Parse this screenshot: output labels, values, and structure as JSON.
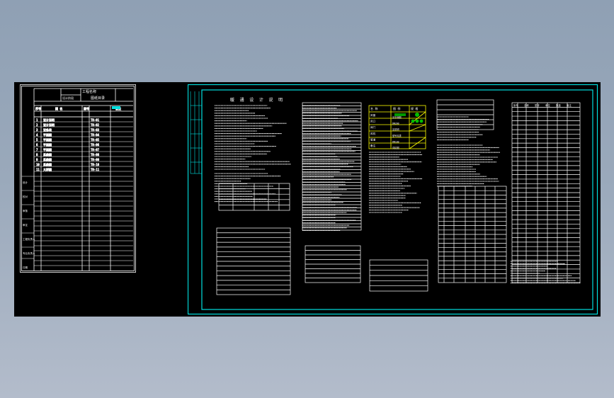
{
  "app": {
    "background": "#95a5b8",
    "canvas_bg": "#000000",
    "line_white": "#ffffff",
    "line_cyan": "#00e0e0",
    "line_yellow": "#ffff00",
    "fill_green": "#00c000"
  },
  "sheet_left": {
    "title_block": {
      "heading": "图纸目录",
      "label_a": "工程名称",
      "label_b": "设计阶段"
    },
    "columns": [
      "序号",
      "图号",
      "图 名",
      "备注"
    ],
    "rows": [
      {
        "num": "1",
        "name": "设计说明",
        "code": "TH-01"
      },
      {
        "num": "2",
        "name": "设计说明",
        "code": "TH-02"
      },
      {
        "num": "3",
        "name": "设备表",
        "code": "TH-03"
      },
      {
        "num": "4",
        "name": "平面图",
        "code": "TH-04"
      },
      {
        "num": "5",
        "name": "平面图",
        "code": "TH-05"
      },
      {
        "num": "6",
        "name": "平面图",
        "code": "TH-06"
      },
      {
        "num": "7",
        "name": "平面图",
        "code": "TH-07"
      },
      {
        "num": "8",
        "name": "系统图",
        "code": "TH-08"
      },
      {
        "num": "9",
        "name": "系统图",
        "code": "TH-09"
      },
      {
        "num": "10",
        "name": "系统图",
        "code": "TH-10"
      },
      {
        "num": "11",
        "name": "大样图",
        "code": "TH-11"
      }
    ],
    "side_labels": [
      "设计",
      "校对",
      "审核",
      "审定",
      "工程负责人",
      "专业负责人",
      "日期"
    ]
  },
  "sheet_right": {
    "title": "暖 通 设 计 说 明",
    "legend": {
      "headers": [
        "名 称",
        "图 例",
        "规 格"
      ],
      "rows": [
        {
          "name": "风管",
          "spec": "见平面图"
        },
        {
          "name": "风口",
          "spec": "DN200"
        },
        {
          "name": "阀门",
          "spec": "见说明"
        },
        {
          "name": "风机",
          "spec": "型号见表"
        },
        {
          "name": "管道",
          "spec": "DN100"
        },
        {
          "name": "备注",
          "spec": "详见图"
        }
      ]
    },
    "equipment_table": {
      "headers": [
        "序号",
        "名称",
        "型号",
        "单位",
        "数量",
        "备注"
      ]
    }
  }
}
